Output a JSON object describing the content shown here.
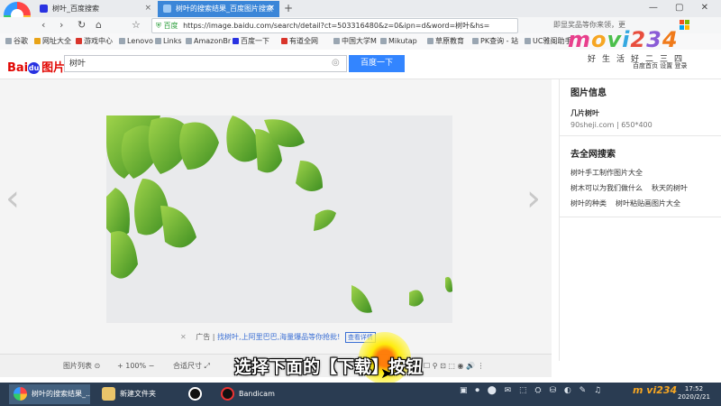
{
  "browser": {
    "tabs": [
      {
        "label": "树叶_百度搜索"
      },
      {
        "label": "树叶的搜索结果_百度图片搜索"
      }
    ],
    "new_tab": "+",
    "window_controls": "— ▢ ✕",
    "nav": {
      "back": "‹",
      "forward": "›",
      "refresh": "↻",
      "home": "⌂",
      "star": "☆"
    },
    "address": {
      "lock": "⛨ 百度",
      "url": "https://image.baidu.com/search/detail?ct=503316480&z=0&ipn=d&word=树叶&hs="
    },
    "right_search": "即显奖品等你来领，更",
    "bookmarks": [
      "谷歌",
      "网址大全",
      "游戏中心",
      "Lenovo",
      "Links",
      "AmazonBr",
      "百度一下",
      "有道全网",
      "中国大学M",
      "Mikutap",
      "草原教育",
      "PK查询 - 站",
      "UC雅阁助手"
    ]
  },
  "watermark": {
    "brand": [
      "m",
      "o",
      "v",
      "i",
      "2",
      "3",
      "4"
    ],
    "sub": "好生活好二三四",
    "small": "m vi234"
  },
  "baidu": {
    "logo_bai": "Bai",
    "logo_du": "du",
    "logo_img": "图片",
    "query": "树叶",
    "camera_icon": "◎",
    "search_button": "百度一下",
    "header_links": "百度首页  设置  登录"
  },
  "viewer": {
    "prev": "‹",
    "next": "›",
    "ad": {
      "close": "✕",
      "label": "广告",
      "text": "找树叶,上阿里巴巴,海量爆品等你抢批!",
      "button": "查看详情"
    },
    "toolbar": {
      "list": "图片列表 ⊙",
      "zoom": "+ 100%  −",
      "fit": "合适尺寸 ⤢",
      "icons_right": "☐  ⚲  ⊡  ⬚  ◉  🔊  ⋮"
    },
    "caption": "选择下面的【下载】按钮"
  },
  "right_panel": {
    "info_title": "图片信息",
    "image_name": "几片树叶",
    "image_meta": "90sheji.com  |  650*400",
    "search_title": "去全网搜索",
    "related": [
      "树叶手工制作图片大全",
      "树木可以为我们做什么",
      "秋天的树叶",
      "树叶的种类",
      "树叶粘贴画图片大全"
    ]
  },
  "taskbar": {
    "items": [
      "树叶的搜索结果_...",
      "新建文件夹",
      "",
      "Bandicam"
    ],
    "tray": "▣ ⏺ ⬤ ✉ ⬚ ⛭ ⛁ ◐ ✎ ♫",
    "time": "17:52",
    "date": "2020/2/21"
  }
}
